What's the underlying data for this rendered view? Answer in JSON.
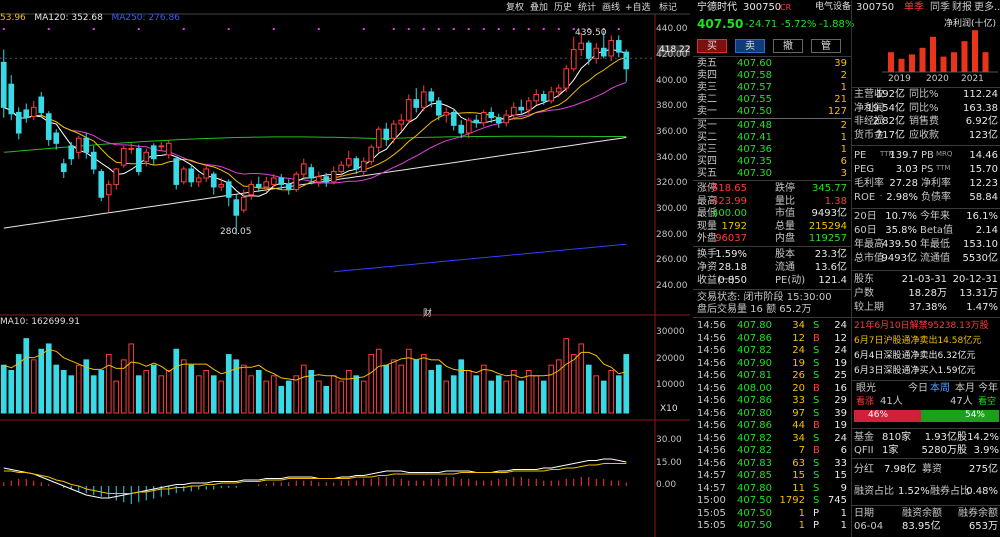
{
  "chart_toolbar": {
    "buttons": [
      "复权",
      "叠加",
      "历史",
      "统计",
      "画线",
      "+自选",
      "标记"
    ],
    "ma_line": {
      "ma60_prefix": "53.96",
      "ma120_label": "MA120: 352.68",
      "ma250_label": "MA250: 276.86"
    },
    "price_axis": [
      "440.00",
      "420.00",
      "400.00",
      "380.00",
      "360.00",
      "340.00",
      "320.00",
      "300.00",
      "280.00",
      "260.00",
      "240.00"
    ],
    "current_price_tag": "418.22",
    "high_label": "439.50",
    "low_label": "280.05",
    "vol_label": "MA10: 162699.91",
    "vol_axis": [
      "30000",
      "20000",
      "10000"
    ],
    "vol_unit": "X10",
    "macd_axis": [
      "30.00",
      "15.00",
      "0.00"
    ],
    "marker_text": "财"
  },
  "chart_data": {
    "type": "candlestick",
    "ylim": [
      230,
      448
    ],
    "candles": [
      {
        "o": 415,
        "c": 380,
        "h": 425,
        "l": 372
      },
      {
        "o": 398,
        "c": 375,
        "h": 405,
        "l": 370
      },
      {
        "o": 376,
        "c": 360,
        "h": 380,
        "l": 355
      },
      {
        "o": 378,
        "c": 372,
        "h": 383,
        "l": 368
      },
      {
        "o": 373,
        "c": 380,
        "h": 385,
        "l": 370
      },
      {
        "o": 388,
        "c": 376,
        "h": 392,
        "l": 373
      },
      {
        "o": 375,
        "c": 355,
        "h": 377,
        "l": 350
      },
      {
        "o": 360,
        "c": 352,
        "h": 363,
        "l": 347
      },
      {
        "o": 336,
        "c": 330,
        "h": 340,
        "l": 325
      },
      {
        "o": 350,
        "c": 340,
        "h": 353,
        "l": 335
      },
      {
        "o": 345,
        "c": 356,
        "h": 358,
        "l": 340
      },
      {
        "o": 356,
        "c": 345,
        "h": 360,
        "l": 340
      },
      {
        "o": 345,
        "c": 332,
        "h": 350,
        "l": 328
      },
      {
        "o": 330,
        "c": 310,
        "h": 332,
        "l": 307
      },
      {
        "o": 312,
        "c": 320,
        "h": 323,
        "l": 298
      },
      {
        "o": 320,
        "c": 332,
        "h": 333,
        "l": 316
      },
      {
        "o": 335,
        "c": 348,
        "h": 350,
        "l": 333
      },
      {
        "o": 348,
        "c": 348,
        "h": 352,
        "l": 344
      },
      {
        "o": 348,
        "c": 330,
        "h": 351,
        "l": 327
      },
      {
        "o": 338,
        "c": 345,
        "h": 348,
        "l": 334
      },
      {
        "o": 350,
        "c": 340,
        "h": 352,
        "l": 335
      },
      {
        "o": 350,
        "c": 350,
        "h": 353,
        "l": 346
      },
      {
        "o": 343,
        "c": 352,
        "h": 354,
        "l": 340
      },
      {
        "o": 340,
        "c": 320,
        "h": 342,
        "l": 316
      },
      {
        "o": 322,
        "c": 332,
        "h": 334,
        "l": 320
      },
      {
        "o": 332,
        "c": 322,
        "h": 335,
        "l": 318
      },
      {
        "o": 322,
        "c": 325,
        "h": 328,
        "l": 318
      },
      {
        "o": 325,
        "c": 332,
        "h": 336,
        "l": 322
      },
      {
        "o": 328,
        "c": 318,
        "h": 330,
        "l": 312
      },
      {
        "o": 318,
        "c": 320,
        "h": 325,
        "l": 315
      },
      {
        "o": 322,
        "c": 310,
        "h": 324,
        "l": 303
      },
      {
        "o": 308,
        "c": 296,
        "h": 312,
        "l": 281
      },
      {
        "o": 300,
        "c": 310,
        "h": 316,
        "l": 298
      },
      {
        "o": 312,
        "c": 320,
        "h": 323,
        "l": 308
      },
      {
        "o": 320,
        "c": 318,
        "h": 326,
        "l": 314
      },
      {
        "o": 318,
        "c": 322,
        "h": 326,
        "l": 314
      },
      {
        "o": 320,
        "c": 325,
        "h": 328,
        "l": 318
      },
      {
        "o": 325,
        "c": 320,
        "h": 328,
        "l": 316
      },
      {
        "o": 320,
        "c": 316,
        "h": 324,
        "l": 312
      },
      {
        "o": 316,
        "c": 328,
        "h": 330,
        "l": 314
      },
      {
        "o": 328,
        "c": 336,
        "h": 340,
        "l": 325
      },
      {
        "o": 333,
        "c": 325,
        "h": 336,
        "l": 320
      },
      {
        "o": 322,
        "c": 326,
        "h": 330,
        "l": 318
      },
      {
        "o": 326,
        "c": 322,
        "h": 329,
        "l": 318
      },
      {
        "o": 322,
        "c": 330,
        "h": 334,
        "l": 320
      },
      {
        "o": 330,
        "c": 335,
        "h": 338,
        "l": 326
      },
      {
        "o": 335,
        "c": 340,
        "h": 346,
        "l": 333
      },
      {
        "o": 340,
        "c": 332,
        "h": 342,
        "l": 328
      },
      {
        "o": 330,
        "c": 338,
        "h": 341,
        "l": 326
      },
      {
        "o": 338,
        "c": 349,
        "h": 351,
        "l": 335
      },
      {
        "o": 349,
        "c": 363,
        "h": 365,
        "l": 345
      },
      {
        "o": 363,
        "c": 355,
        "h": 368,
        "l": 350
      },
      {
        "o": 356,
        "c": 367,
        "h": 370,
        "l": 352
      },
      {
        "o": 367,
        "c": 370,
        "h": 375,
        "l": 361
      },
      {
        "o": 370,
        "c": 386,
        "h": 390,
        "l": 367
      },
      {
        "o": 386,
        "c": 380,
        "h": 395,
        "l": 376
      },
      {
        "o": 380,
        "c": 392,
        "h": 397,
        "l": 377
      },
      {
        "o": 392,
        "c": 385,
        "h": 395,
        "l": 380
      },
      {
        "o": 385,
        "c": 374,
        "h": 388,
        "l": 370
      },
      {
        "o": 374,
        "c": 376,
        "h": 380,
        "l": 368
      },
      {
        "o": 376,
        "c": 366,
        "h": 378,
        "l": 362
      },
      {
        "o": 366,
        "c": 360,
        "h": 370,
        "l": 356
      },
      {
        "o": 360,
        "c": 370,
        "h": 372,
        "l": 356
      },
      {
        "o": 370,
        "c": 368,
        "h": 374,
        "l": 364
      },
      {
        "o": 368,
        "c": 376,
        "h": 378,
        "l": 365
      },
      {
        "o": 376,
        "c": 372,
        "h": 380,
        "l": 368
      },
      {
        "o": 372,
        "c": 368,
        "h": 375,
        "l": 364
      },
      {
        "o": 368,
        "c": 374,
        "h": 378,
        "l": 365
      },
      {
        "o": 374,
        "c": 380,
        "h": 384,
        "l": 371
      },
      {
        "o": 380,
        "c": 378,
        "h": 386,
        "l": 374
      },
      {
        "o": 378,
        "c": 385,
        "h": 388,
        "l": 375
      },
      {
        "o": 385,
        "c": 390,
        "h": 394,
        "l": 382
      },
      {
        "o": 390,
        "c": 385,
        "h": 393,
        "l": 382
      },
      {
        "o": 385,
        "c": 392,
        "h": 396,
        "l": 383
      },
      {
        "o": 392,
        "c": 395,
        "h": 398,
        "l": 388
      },
      {
        "o": 395,
        "c": 410,
        "h": 413,
        "l": 392
      },
      {
        "o": 410,
        "c": 425,
        "h": 435,
        "l": 408
      },
      {
        "o": 425,
        "c": 430,
        "h": 438,
        "l": 420
      },
      {
        "o": 430,
        "c": 418,
        "h": 432,
        "l": 413
      },
      {
        "o": 418,
        "c": 426,
        "h": 430,
        "l": 414
      },
      {
        "o": 426,
        "c": 420,
        "h": 439.5,
        "l": 418
      },
      {
        "o": 420,
        "c": 432,
        "h": 436,
        "l": 416
      },
      {
        "o": 432,
        "c": 423,
        "h": 436,
        "l": 419
      },
      {
        "o": 423,
        "c": 410,
        "h": 425,
        "l": 400
      }
    ],
    "volume": [
      18,
      16,
      22,
      28,
      20,
      24,
      26,
      18,
      16,
      14,
      18,
      20,
      14,
      16,
      22,
      12,
      20,
      26,
      14,
      16,
      18,
      14,
      16,
      24,
      20,
      18,
      14,
      16,
      14,
      12,
      22,
      20,
      18,
      14,
      16,
      12,
      14,
      10,
      12,
      14,
      18,
      16,
      12,
      10,
      14,
      12,
      16,
      14,
      12,
      22,
      24,
      18,
      20,
      18,
      24,
      20,
      22,
      16,
      18,
      12,
      14,
      20,
      16,
      14,
      18,
      12,
      14,
      12,
      16,
      12,
      16,
      14,
      12,
      18,
      20,
      28,
      22,
      26,
      18,
      14,
      12,
      16,
      14,
      22
    ],
    "vol_ylim": [
      0,
      32000
    ],
    "macd_hist": [
      2,
      3,
      4,
      4,
      3,
      2,
      1,
      0,
      -1,
      -2,
      -3,
      -4,
      -5,
      -6,
      -7,
      -8,
      -9,
      -10,
      -9,
      -8,
      -7,
      -6,
      -5,
      -4,
      -3,
      -3,
      -2,
      -2,
      -2,
      -1,
      -1,
      -1,
      0,
      0,
      1,
      1,
      2,
      2,
      2,
      3,
      3,
      3,
      2,
      2,
      2,
      3,
      3,
      3,
      4,
      4,
      5,
      5,
      4,
      4,
      3,
      3,
      3,
      4,
      4,
      5,
      5,
      4,
      4,
      3,
      3,
      3,
      4,
      4,
      5,
      5,
      4,
      4,
      3,
      3,
      3,
      4,
      4,
      5,
      5,
      4,
      4,
      3,
      3,
      2
    ],
    "series_dif": [
      12,
      11,
      10,
      9,
      8,
      6,
      4,
      2,
      0,
      -2,
      -4,
      -6,
      -7,
      -8,
      -8,
      -7,
      -6,
      -5,
      -4,
      -3,
      -2,
      -1,
      0,
      1,
      1,
      2,
      2,
      2,
      3,
      3,
      3,
      3,
      4,
      4,
      4,
      5,
      5,
      5,
      6,
      6,
      6,
      6,
      5,
      5,
      5,
      6,
      6,
      7,
      7,
      8,
      9,
      10,
      10,
      10,
      9,
      9,
      9,
      9,
      9,
      10,
      10,
      10,
      10,
      9,
      9,
      9,
      10,
      10,
      11,
      11,
      11,
      11,
      12,
      12,
      13,
      14,
      15,
      16,
      17,
      17,
      18,
      18,
      17,
      16
    ],
    "series_dea": [
      10,
      10,
      9,
      9,
      8,
      7,
      6,
      4,
      3,
      1,
      0,
      -2,
      -3,
      -4,
      -5,
      -5,
      -5,
      -5,
      -4,
      -4,
      -3,
      -2,
      -2,
      -1,
      -1,
      0,
      0,
      1,
      1,
      2,
      2,
      2,
      3,
      3,
      3,
      4,
      4,
      4,
      5,
      5,
      5,
      5,
      5,
      5,
      5,
      5,
      5,
      6,
      6,
      6,
      7,
      7,
      8,
      8,
      8,
      8,
      8,
      8,
      8,
      8,
      8,
      9,
      9,
      9,
      9,
      9,
      9,
      9,
      10,
      10,
      10,
      10,
      10,
      11,
      11,
      12,
      12,
      13,
      14,
      14,
      15,
      15,
      15,
      15
    ]
  },
  "quote": {
    "name": "宁德时代",
    "code": "300750",
    "badge": "CR",
    "sector": "电气设备",
    "price": "407.50",
    "change": "-24.71",
    "change_pct": "-5.72%",
    "sector_pct": "-1.88%",
    "buttons": [
      "买",
      "卖",
      "撤",
      "管"
    ],
    "asks": [
      [
        "卖五",
        "407.60",
        "39"
      ],
      [
        "卖四",
        "407.58",
        "2"
      ],
      [
        "卖三",
        "407.57",
        "1"
      ],
      [
        "卖二",
        "407.55",
        "21"
      ],
      [
        "卖一",
        "407.50",
        "127"
      ]
    ],
    "bids": [
      [
        "买一",
        "407.48",
        "2"
      ],
      [
        "买二",
        "407.41",
        "1"
      ],
      [
        "买三",
        "407.36",
        "1"
      ],
      [
        "买四",
        "407.35",
        "6"
      ],
      [
        "买五",
        "407.30",
        "3"
      ]
    ],
    "stats": [
      [
        "涨停",
        "518.65",
        "跌停",
        "345.77"
      ],
      [
        "最高",
        "423.99",
        "量比",
        "1.38"
      ],
      [
        "最低",
        "400.00",
        "市值",
        "9493亿"
      ],
      [
        "现量",
        "1792",
        "总量",
        "215294"
      ],
      [
        "外盘",
        "96037",
        "内盘",
        "119257"
      ]
    ],
    "stats2": [
      [
        "换手",
        "1.59%",
        "股本",
        "23.3亿"
      ],
      [
        "净资",
        "28.18",
        "流通",
        "13.6亿"
      ],
      [
        "收益(一)",
        "0.850",
        "PE(动)",
        "121.4"
      ]
    ],
    "trade_status": "交易状态: 闭市阶段 15:30:00",
    "after_hours": "盘后交易量 16 额 65.2万",
    "ticks": [
      [
        "14:56",
        "407.80",
        "34",
        "S",
        "24"
      ],
      [
        "14:56",
        "407.86",
        "12",
        "B",
        "12"
      ],
      [
        "14:56",
        "407.82",
        "24",
        "S",
        "24"
      ],
      [
        "14:56",
        "407.90",
        "19",
        "S",
        "19"
      ],
      [
        "14:56",
        "407.81",
        "26",
        "S",
        "25"
      ],
      [
        "14:56",
        "408.00",
        "20",
        "B",
        "16"
      ],
      [
        "14:56",
        "407.86",
        "33",
        "S",
        "29"
      ],
      [
        "14:56",
        "407.80",
        "97",
        "S",
        "39"
      ],
      [
        "14:56",
        "407.86",
        "44",
        "B",
        "19"
      ],
      [
        "14:56",
        "407.82",
        "34",
        "S",
        "24"
      ],
      [
        "14:56",
        "407.82",
        "7",
        "B",
        "6"
      ],
      [
        "14:56",
        "407.83",
        "63",
        "S",
        "33"
      ],
      [
        "14:57",
        "407.85",
        "15",
        "S",
        "15"
      ],
      [
        "14:57",
        "407.80",
        "11",
        "S",
        "9"
      ],
      [
        "15:00",
        "407.50",
        "1792",
        "S",
        "745"
      ],
      [
        "15:05",
        "407.50",
        "1",
        "P",
        "1"
      ],
      [
        "15:05",
        "407.50",
        "1",
        "P",
        "1"
      ]
    ]
  },
  "right": {
    "code": "300750",
    "tabs": [
      "单季",
      "同季",
      "财报",
      "更多.."
    ],
    "chart_title": "净利润(十亿)",
    "years": [
      "2019",
      "2020",
      "2021"
    ],
    "bars": [
      0.9,
      0.6,
      0.8,
      1.1,
      1.6,
      0.7,
      0.9,
      1.4,
      1.9,
      0.9
    ],
    "fin": [
      [
        "主营收",
        "192亿",
        "同比%",
        "112.24"
      ],
      [
        "净利润",
        "19.54亿",
        "同比%",
        "163.38"
      ],
      [
        "非经损",
        "2.82亿",
        "销售费",
        "6.92亿"
      ],
      [
        "货币金",
        "717亿",
        "应收款",
        "123亿"
      ]
    ],
    "val": [
      [
        "PE",
        "TTM",
        "139.7",
        "PB",
        "MRQ",
        "14.46"
      ],
      [
        "PEG",
        "",
        "3.03",
        "PS",
        "TTM",
        "15.70"
      ],
      [
        "毛利率",
        "",
        "27.28",
        "净利率",
        "",
        "12.23"
      ],
      [
        "ROE",
        "-",
        "2.98%",
        "负债率",
        "",
        "58.84"
      ]
    ],
    "perf": [
      [
        "20日",
        "10.7%",
        "今年来",
        "16.1%"
      ],
      [
        "60日",
        "35.8%",
        "Beta值",
        "2.14"
      ],
      [
        "年最高",
        "439.50",
        "年最低",
        "153.10"
      ],
      [
        "总市值",
        "9493亿",
        "流通值",
        "5530亿"
      ]
    ],
    "holders": [
      [
        "股东",
        "21-03-31",
        "20-12-31"
      ],
      [
        "户数",
        "18.28万",
        "13.31万"
      ],
      [
        "较上期",
        "37.38%",
        "1.47%"
      ]
    ],
    "news": [
      "21年6月10日解禁95238.13万股",
      "6月7日沪股通净卖出14.58亿元",
      "6月4日深股通净卖出6.32亿元",
      "6月3日深股通净买入1.59亿元"
    ],
    "eye_label": "眼光",
    "eye_tabs": [
      "今日",
      "本周",
      "本月",
      "今年"
    ],
    "bull_count": "41人",
    "bear_count": "47人",
    "bull_label": "看涨",
    "bear_label": "看空",
    "bull_pct": "46%",
    "bear_pct": "54%",
    "bull_frac": 0.46,
    "misc": [
      [
        "基金",
        "810家",
        "1.93亿股",
        "14.2%"
      ],
      [
        "QFII",
        "1家",
        "5280万股",
        "3.9%"
      ]
    ],
    "div": [
      "分红",
      "7.98亿",
      "募资",
      "275亿"
    ],
    "margin": [
      "融资占比",
      "1.52%",
      "融券占比",
      "0.48%"
    ],
    "margin_hdr": [
      "日期",
      "融资余额",
      "融券余额"
    ],
    "margin_rows": [
      [
        "06-04",
        "83.95亿",
        "653万"
      ]
    ]
  },
  "colors": {
    "up": "#ff3b3b",
    "down": "#39d9e6",
    "ma5": "#ffffff",
    "ma10": "#f0c000",
    "ma20": "#e040e0",
    "ma60": "#20c020",
    "ma120": "#e8e8e8",
    "ma250": "#3040ff"
  }
}
